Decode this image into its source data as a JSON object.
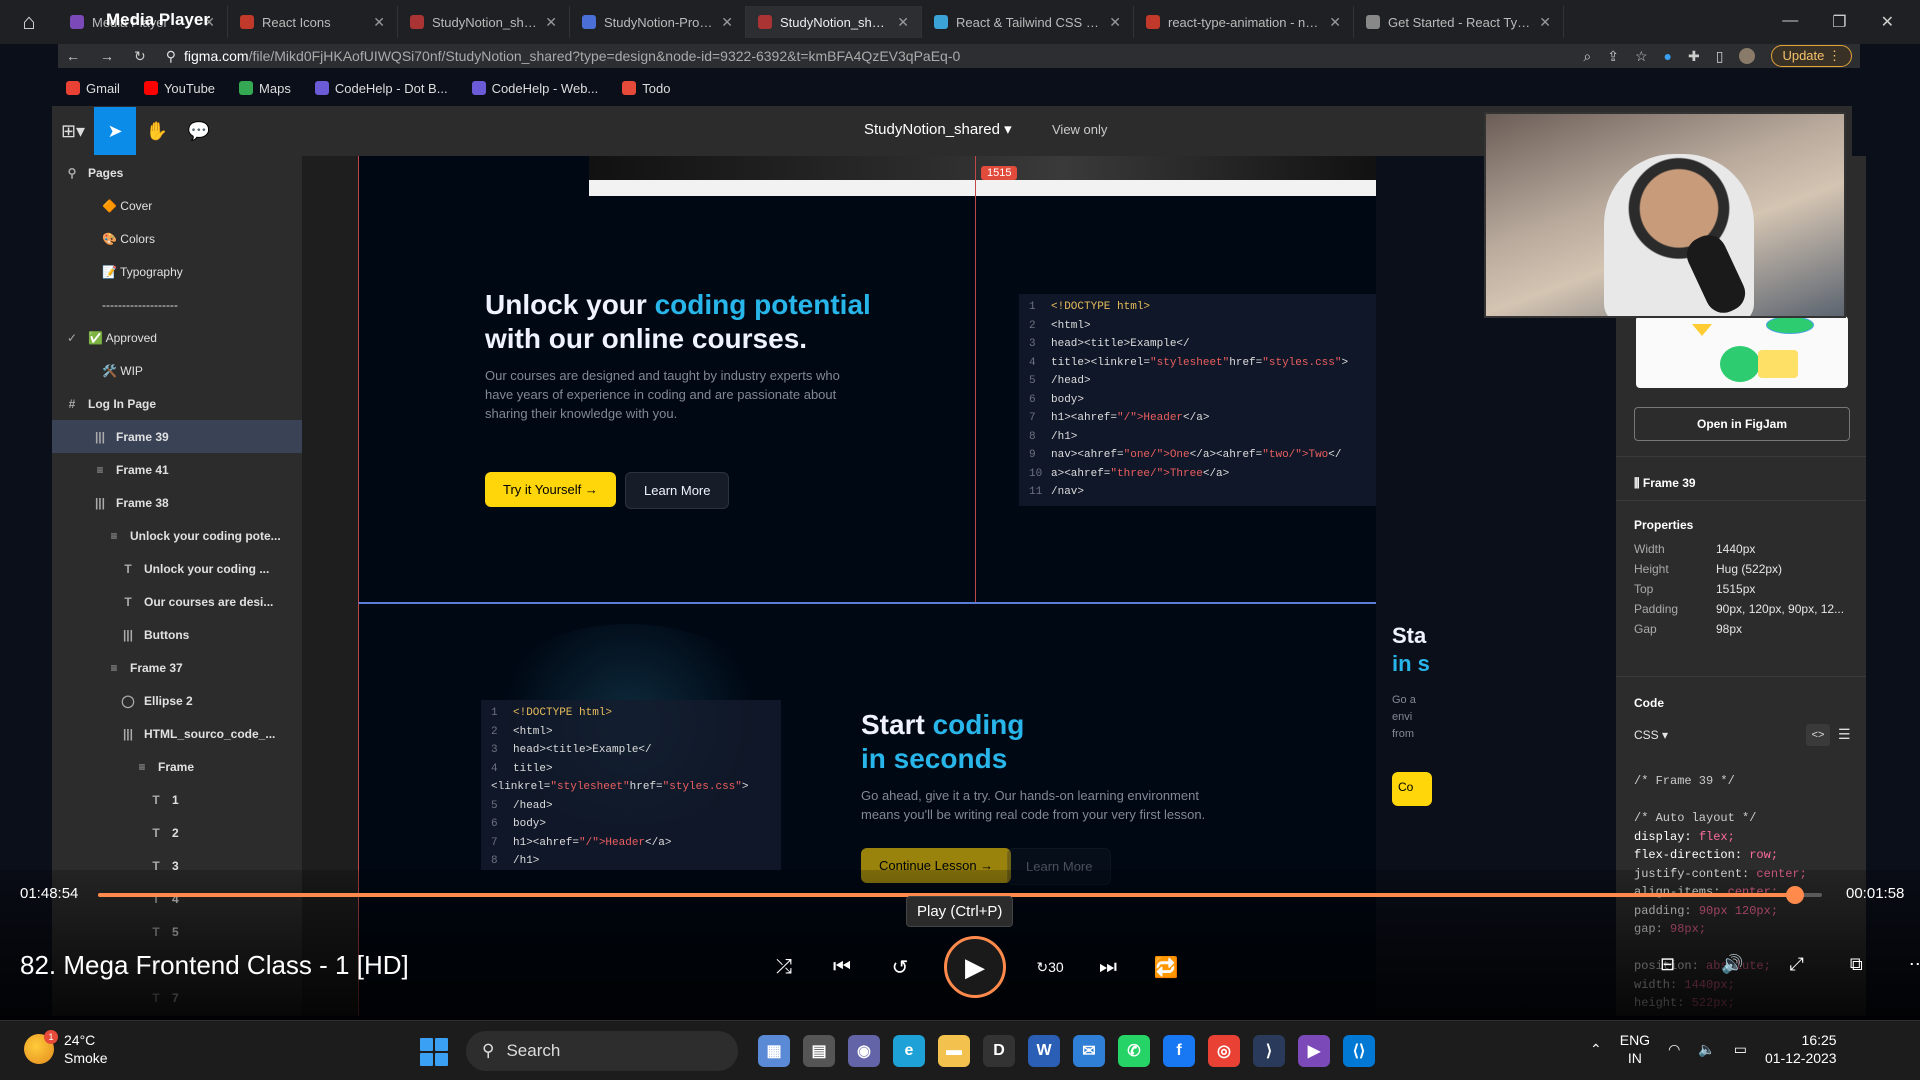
{
  "browser": {
    "tabs": [
      {
        "label": "Media Player",
        "color": "#7b4ab8",
        "active": false
      },
      {
        "label": "React Icons",
        "color": "#c0392b",
        "active": false
      },
      {
        "label": "StudyNotion_shared (Copy)",
        "color": "#a33",
        "active": false
      },
      {
        "label": "StudyNotion-Project Descri",
        "color": "#4a6fd6",
        "active": false
      },
      {
        "label": "StudyNotion_shared – Figm",
        "color": "#a33",
        "active": true
      },
      {
        "label": "React & Tailwind CSS Starte",
        "color": "#3ba3d6",
        "active": false
      },
      {
        "label": "react-type-animation - npm",
        "color": "#c0392b",
        "active": false
      },
      {
        "label": "Get Started - React Type An",
        "color": "#888",
        "active": false
      }
    ],
    "url_domain": "figma.com",
    "url_rest": "/file/Mikd0FjHKAofUIWQSi70nf/StudyNotion_shared?type=design&node-id=9322-6392&t=kmBFA4QzEV3qPaEq-0",
    "update_label": "Update",
    "bookmarks": [
      {
        "label": "Gmail",
        "color": "#e94235"
      },
      {
        "label": "YouTube",
        "color": "#ff0000"
      },
      {
        "label": "Maps",
        "color": "#34a853"
      },
      {
        "label": "CodeHelp - Dot B...",
        "color": "#6b5bd6"
      },
      {
        "label": "CodeHelp - Web...",
        "color": "#6b5bd6"
      },
      {
        "label": "Todo",
        "color": "#e64a3b"
      }
    ]
  },
  "figma": {
    "file_title": "StudyNotion_shared",
    "view_only": "View only",
    "pages_label": "Pages",
    "layers": [
      {
        "label": "Pages",
        "icon": "search-icon",
        "indent": 0,
        "head": true,
        "selected": false
      },
      {
        "label": "🔶 Cover",
        "icon": "",
        "indent": 1,
        "head": false,
        "selected": false
      },
      {
        "label": "🎨 Colors",
        "icon": "",
        "indent": 1,
        "head": false,
        "selected": false
      },
      {
        "label": "📝 Typography",
        "icon": "",
        "indent": 1,
        "head": false,
        "selected": false
      },
      {
        "label": "-------------------",
        "icon": "",
        "indent": 1,
        "head": false,
        "selected": false
      },
      {
        "label": "✅ Approved",
        "icon": "✓",
        "indent": 0,
        "head": false,
        "selected": false
      },
      {
        "label": "🛠️ WIP",
        "icon": "",
        "indent": 1,
        "head": false,
        "selected": false
      },
      {
        "label": "Log In Page",
        "icon": "#",
        "indent": 0,
        "head": true,
        "selected": false
      },
      {
        "label": "Frame 39",
        "icon": "|||",
        "indent": 2,
        "head": true,
        "selected": true
      },
      {
        "label": "Frame 41",
        "icon": "≡",
        "indent": 2,
        "head": true,
        "selected": false
      },
      {
        "label": "Frame 38",
        "icon": "|||",
        "indent": 2,
        "head": true,
        "selected": false
      },
      {
        "label": "Unlock your coding pote...",
        "icon": "≡",
        "indent": 3,
        "head": true,
        "selected": false
      },
      {
        "label": "Unlock your coding ...",
        "icon": "T",
        "indent": 4,
        "head": true,
        "selected": false
      },
      {
        "label": "Our courses are desi...",
        "icon": "T",
        "indent": 4,
        "head": true,
        "selected": false
      },
      {
        "label": "Buttons",
        "icon": "|||",
        "indent": 4,
        "head": true,
        "selected": false
      },
      {
        "label": "Frame 37",
        "icon": "≡",
        "indent": 3,
        "head": true,
        "selected": false
      },
      {
        "label": "Ellipse 2",
        "icon": "◯",
        "indent": 4,
        "head": true,
        "selected": false
      },
      {
        "label": "HTML_sourco_code_...",
        "icon": "|||",
        "indent": 4,
        "head": true,
        "selected": false
      },
      {
        "label": "Frame",
        "icon": "≡",
        "indent": 5,
        "head": true,
        "selected": false
      },
      {
        "label": "1",
        "icon": "T",
        "indent": 6,
        "head": true,
        "selected": false
      },
      {
        "label": "2",
        "icon": "T",
        "indent": 6,
        "head": true,
        "selected": false
      },
      {
        "label": "3",
        "icon": "T",
        "indent": 6,
        "head": true,
        "selected": false
      },
      {
        "label": "4",
        "icon": "T",
        "indent": 6,
        "head": true,
        "selected": false
      },
      {
        "label": "5",
        "icon": "T",
        "indent": 6,
        "head": true,
        "selected": false
      },
      {
        "label": "",
        "icon": "T",
        "indent": 6,
        "head": true,
        "selected": false
      },
      {
        "label": "7",
        "icon": "T",
        "indent": 6,
        "head": true,
        "selected": false
      }
    ],
    "badge": "1515",
    "section1": {
      "heading_a": "Unlock your ",
      "heading_b": "coding potential",
      "heading_c": "with our online courses.",
      "paragraph": "Our courses are designed and taught by industry experts who have years of experience in coding and are passionate about sharing their knowledge with you.",
      "btn_primary": "Try it Yourself →",
      "btn_secondary": "Learn More"
    },
    "section2": {
      "heading_a": "Start ",
      "heading_b": "coding",
      "heading_c": "in seconds",
      "paragraph": "Go ahead, give it a try. Our hands-on learning environment means you'll be writing real code from your very first lesson.",
      "btn_primary": "Continue Lesson →",
      "btn_secondary": "Learn More"
    },
    "code_lines": [
      [
        {
          "t": "<!DOCTYPE html>",
          "c": "c-y"
        }
      ],
      [
        {
          "t": "<html>",
          "c": "c-w"
        }
      ],
      [
        {
          "t": "head><title>Example</",
          "c": "c-w"
        }
      ],
      [
        {
          "t": "title><linkrel=",
          "c": "c-w"
        },
        {
          "t": "\"stylesheet\"",
          "c": "c-r"
        },
        {
          "t": "href=",
          "c": "c-w"
        },
        {
          "t": "\"styles.css\"",
          "c": "c-r"
        },
        {
          "t": ">",
          "c": "c-w"
        }
      ],
      [
        {
          "t": "/head>",
          "c": "c-w"
        }
      ],
      [
        {
          "t": "body>",
          "c": "c-w"
        }
      ],
      [
        {
          "t": "h1><ahref=",
          "c": "c-w"
        },
        {
          "t": "\"/\">Header",
          "c": "c-r"
        },
        {
          "t": "</a>",
          "c": "c-w"
        }
      ],
      [
        {
          "t": "/h1>",
          "c": "c-w"
        }
      ],
      [
        {
          "t": "nav><ahref=",
          "c": "c-w"
        },
        {
          "t": "\"one/\">One",
          "c": "c-r"
        },
        {
          "t": "</a><ahref=",
          "c": "c-w"
        },
        {
          "t": "\"two/\">Two",
          "c": "c-r"
        },
        {
          "t": "</",
          "c": "c-w"
        }
      ],
      [
        {
          "t": "a><ahref=",
          "c": "c-w"
        },
        {
          "t": "\"three/\">Three",
          "c": "c-r"
        },
        {
          "t": "</a>",
          "c": "c-w"
        }
      ],
      [
        {
          "t": "/nav>",
          "c": "c-w"
        }
      ]
    ],
    "right_panel": {
      "open_figjam": "Open in FigJam",
      "frame_name": "Frame 39",
      "properties_label": "Properties",
      "properties": [
        {
          "label": "Width",
          "value": "1440px"
        },
        {
          "label": "Height",
          "value": "Hug (522px)"
        },
        {
          "label": "Top",
          "value": "1515px"
        },
        {
          "label": "Padding",
          "value": "90px, 120px, 90px, 12..."
        },
        {
          "label": "Gap",
          "value": "98px"
        }
      ],
      "code_label": "Code",
      "lang": "CSS",
      "css_lines": [
        {
          "t": "/* Frame 39 */",
          "c": "cm"
        },
        {
          "t": "",
          "c": "cm"
        },
        {
          "t": "/* Auto layout */",
          "c": "cm"
        },
        {
          "k": "display: ",
          "v": "flex;"
        },
        {
          "k": "flex-direction: ",
          "v": "row;"
        },
        {
          "k": "justify-content: ",
          "v": "center;"
        },
        {
          "k": "align-items: ",
          "v": "center;"
        },
        {
          "k": "padding: ",
          "v": "90px 120px;"
        },
        {
          "k": "gap: ",
          "v": "98px;"
        },
        {
          "t": "",
          "c": "cm"
        },
        {
          "k": "position: ",
          "v": "absolute;"
        },
        {
          "k": "width: ",
          "v": "1440px;"
        },
        {
          "k": "height: ",
          "v": "522px;"
        }
      ]
    }
  },
  "media_player": {
    "app_title": "Media Player",
    "time_elapsed": "01:48:54",
    "time_remaining": "00:01:58",
    "progress": 0.9842,
    "tooltip": "Play (Ctrl+P)",
    "episode_title": "82. Mega Frontend Class - 1 [HD]",
    "skip_seconds": "30"
  },
  "taskbar": {
    "temp": "24°C",
    "condition": "Smoke",
    "weather_badge": "1",
    "search_label": "Search",
    "lang_top": "ENG",
    "lang_bottom": "IN",
    "time": "16:25",
    "date": "01-12-2023",
    "apps": [
      {
        "name": "widgets-app",
        "color": "#5a8ad6",
        "glyph": "▦"
      },
      {
        "name": "file-explorer-app",
        "color": "#555",
        "glyph": "▤"
      },
      {
        "name": "teams-app",
        "color": "#6264a7",
        "glyph": "◉"
      },
      {
        "name": "edge-app",
        "color": "#1da1d6",
        "glyph": "e"
      },
      {
        "name": "folder-app",
        "color": "#f2c14e",
        "glyph": "▬"
      },
      {
        "name": "dell-app",
        "color": "#333",
        "glyph": "D"
      },
      {
        "name": "word-app",
        "color": "#2b5fb5",
        "glyph": "W"
      },
      {
        "name": "mail-app",
        "color": "#2f7fd6",
        "glyph": "✉"
      },
      {
        "name": "whatsapp-app",
        "color": "#25d366",
        "glyph": "✆"
      },
      {
        "name": "facebook-app",
        "color": "#1877f2",
        "glyph": "f"
      },
      {
        "name": "chrome-app",
        "color": "#e94235",
        "glyph": "◎"
      },
      {
        "name": "terminal-app",
        "color": "#2a3a5a",
        "glyph": "⟩"
      },
      {
        "name": "media-player-app",
        "color": "#7b4ab8",
        "glyph": "▶"
      },
      {
        "name": "vscode-app",
        "color": "#0078d4",
        "glyph": "⟨⟩"
      }
    ]
  }
}
